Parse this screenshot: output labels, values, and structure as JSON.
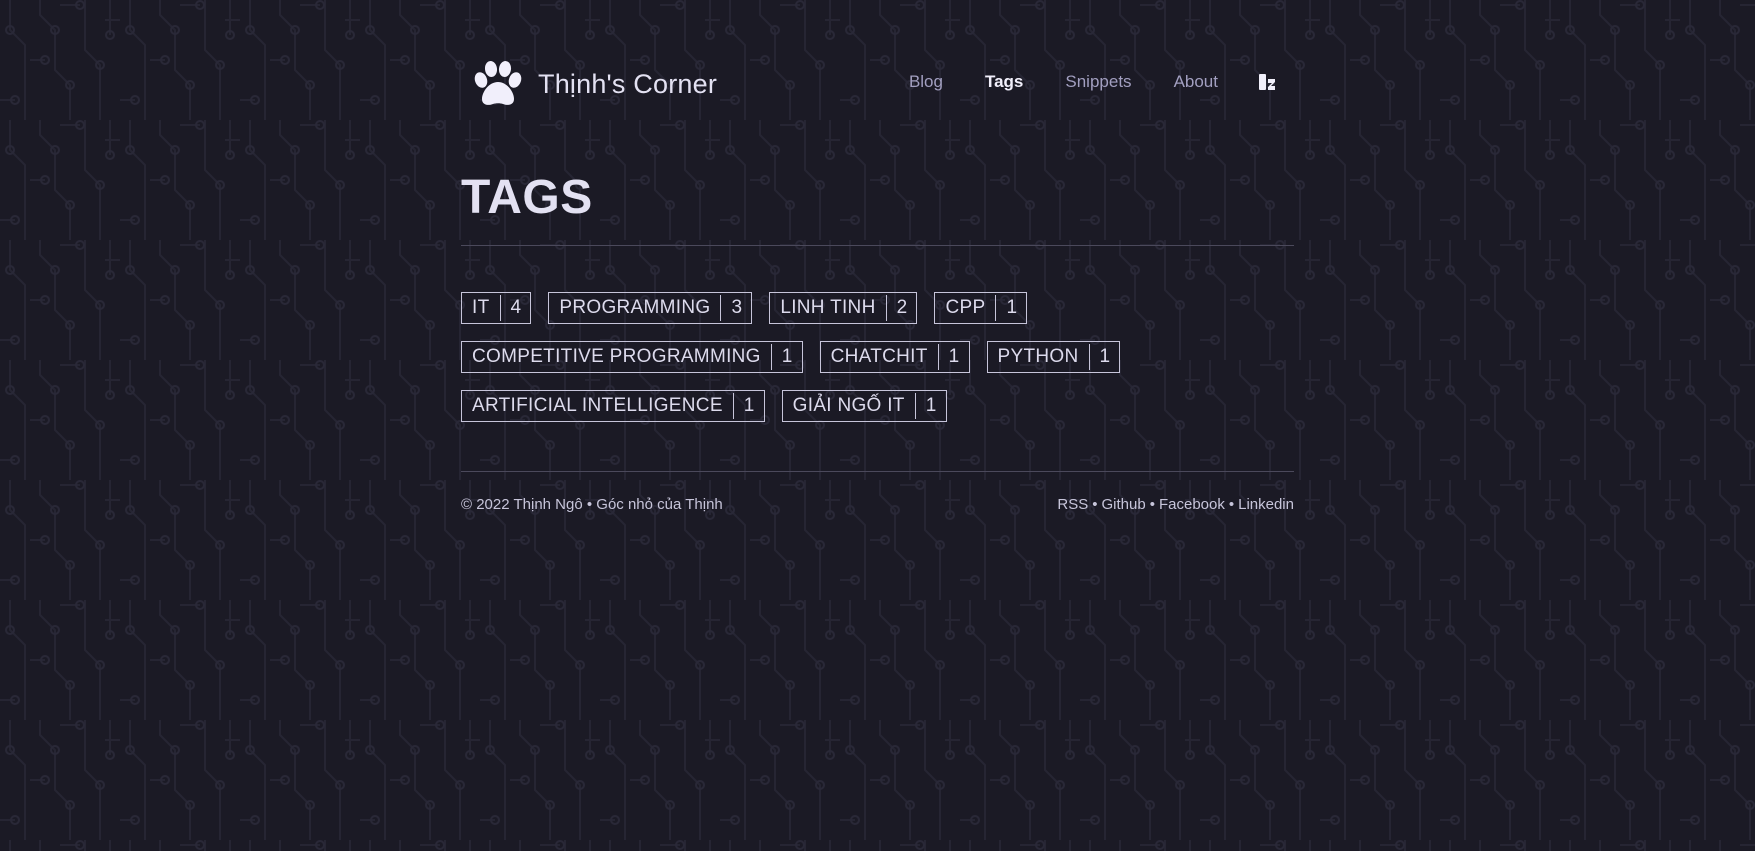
{
  "site": {
    "title": "Thịnh's Corner"
  },
  "nav": {
    "items": [
      {
        "label": "Blog",
        "active": false
      },
      {
        "label": "Tags",
        "active": true
      },
      {
        "label": "Snippets",
        "active": false
      },
      {
        "label": "About",
        "active": false
      }
    ],
    "theme_icon": "theme-toggle-icon"
  },
  "page": {
    "title": "TAGS"
  },
  "tags": [
    {
      "name": "IT",
      "count": "4"
    },
    {
      "name": "PROGRAMMING",
      "count": "3"
    },
    {
      "name": "LINH TINH",
      "count": "2"
    },
    {
      "name": "CPP",
      "count": "1"
    },
    {
      "name": "COMPETITIVE PROGRAMMING",
      "count": "1"
    },
    {
      "name": "CHATCHIT",
      "count": "1"
    },
    {
      "name": "PYTHON",
      "count": "1"
    },
    {
      "name": "ARTIFICIAL INTELLIGENCE",
      "count": "1"
    },
    {
      "name": "GIẢI NGỐ IT",
      "count": "1"
    }
  ],
  "footer": {
    "copyright": "© 2022 Thịnh Ngô • Góc nhỏ của Thịnh",
    "links": [
      "RSS",
      "Github",
      "Facebook",
      "Linkedin"
    ]
  },
  "colors": {
    "background": "#1b1a25",
    "text": "#d9d7ea",
    "nav_inactive": "#a29fc0"
  }
}
